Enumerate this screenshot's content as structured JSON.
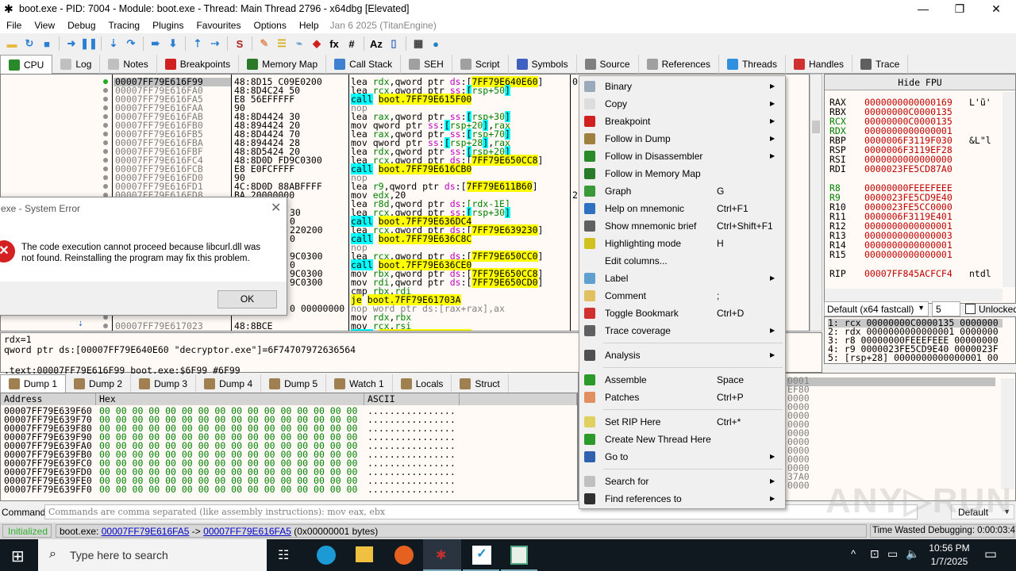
{
  "window": {
    "title": "boot.exe - PID: 7004 - Module: boot.exe - Thread: Main Thread 2796 - x64dbg [Elevated]",
    "min": "—",
    "max": "❐",
    "close": "✕"
  },
  "menu": [
    "File",
    "View",
    "Debug",
    "Tracing",
    "Plugins",
    "Favourites",
    "Options",
    "Help"
  ],
  "version": "Jan 6 2025 (TitanEngine)",
  "toolbar": [
    {
      "name": "open-icon",
      "glyph": "▬",
      "color": "#e8b840"
    },
    {
      "name": "restart-icon",
      "glyph": "↻",
      "color": "#2a7fd4"
    },
    {
      "name": "stop-icon",
      "glyph": "■",
      "color": "#2a7fd4"
    },
    {
      "sep": true
    },
    {
      "name": "run-icon",
      "glyph": "➜",
      "color": "#2a7fd4"
    },
    {
      "name": "pause-icon",
      "glyph": "❚❚",
      "color": "#2a7fd4"
    },
    {
      "sep": true
    },
    {
      "name": "step-into-icon",
      "glyph": "⇣",
      "color": "#2a7fd4"
    },
    {
      "name": "step-over-icon",
      "glyph": "↷",
      "color": "#2a7fd4"
    },
    {
      "sep": true
    },
    {
      "name": "trace-into-icon",
      "glyph": "➠",
      "color": "#2a7fd4"
    },
    {
      "name": "trace-over-icon",
      "glyph": "⬇",
      "color": "#2a7fd4"
    },
    {
      "sep": true
    },
    {
      "name": "execute-till-return-icon",
      "glyph": "⇡",
      "color": "#2a7fd4"
    },
    {
      "name": "run-to-user-code-icon",
      "glyph": "⇢",
      "color": "#2a7fd4"
    },
    {
      "sep": true
    },
    {
      "name": "scylla-icon",
      "glyph": "S",
      "color": "#b02020"
    },
    {
      "sep": true
    },
    {
      "name": "patches-icon",
      "glyph": "✎",
      "color": "#e09060"
    },
    {
      "name": "comments-icon",
      "glyph": "☰",
      "color": "#d4b020"
    },
    {
      "name": "labels-icon",
      "glyph": "⌁",
      "color": "#60a0d0"
    },
    {
      "name": "bookmarks-icon",
      "glyph": "◆",
      "color": "#d02020"
    },
    {
      "name": "functions-icon",
      "glyph": "fx",
      "color": "#000"
    },
    {
      "name": "hash-icon",
      "glyph": "#",
      "color": "#000"
    },
    {
      "sep": true
    },
    {
      "name": "strings-icon",
      "glyph": "Az",
      "color": "#000"
    },
    {
      "name": "device-icon",
      "glyph": "▯",
      "color": "#4070c0"
    },
    {
      "sep": true
    },
    {
      "name": "calculator-icon",
      "glyph": "▦",
      "color": "#404040"
    },
    {
      "name": "globe-icon",
      "glyph": "●",
      "color": "#2080c0"
    }
  ],
  "tabs": [
    {
      "label": "CPU",
      "icon": "cpu-icon",
      "color": "#2a8a2a",
      "active": true
    },
    {
      "label": "Log",
      "icon": "log-icon",
      "color": "#c0c0c0"
    },
    {
      "label": "Notes",
      "icon": "notes-icon",
      "color": "#c0c0c0"
    },
    {
      "label": "Breakpoints",
      "icon": "breakpoint-icon",
      "color": "#d02020"
    },
    {
      "label": "Memory Map",
      "icon": "memory-map-icon",
      "color": "#2a7a2a"
    },
    {
      "label": "Call Stack",
      "icon": "call-stack-icon",
      "color": "#4080d0"
    },
    {
      "label": "SEH",
      "icon": "seh-icon",
      "color": "#a0a0a0"
    },
    {
      "label": "Script",
      "icon": "script-icon",
      "color": "#a0a0a0"
    },
    {
      "label": "Symbols",
      "icon": "symbols-icon",
      "color": "#4060c0"
    },
    {
      "label": "Source",
      "icon": "source-icon",
      "color": "#808080"
    },
    {
      "label": "References",
      "icon": "references-icon",
      "color": "#a0a0a0"
    },
    {
      "label": "Threads",
      "icon": "threads-icon",
      "color": "#3090e0"
    },
    {
      "label": "Handles",
      "icon": "handles-icon",
      "color": "#d03030"
    },
    {
      "label": "Trace",
      "icon": "trace-icon",
      "color": "#606060"
    }
  ],
  "disasm": [
    {
      "addr": "00007FF79E616F99",
      "bytes": "48:8D15 C09E0200",
      "ins": "lea rdx,qword ptr ds:[7FF79E640E60]",
      "cmt": "0",
      "sel": true
    },
    {
      "addr": "00007FF79E616FA0",
      "bytes": "48:8D4C24 50",
      "ins": "lea rcx,qword ptr ss:[rsp+50]"
    },
    {
      "addr": "00007FF79E616FA5",
      "bytes": "E8 56EFFFFF",
      "ins": "call boot.7FF79E615F00"
    },
    {
      "addr": "00007FF79E616FAA",
      "bytes": "90",
      "ins": "nop"
    },
    {
      "addr": "00007FF79E616FAB",
      "bytes": "48:8D4424 30",
      "ins": "lea rax,qword ptr ss:[rsp+30]"
    },
    {
      "addr": "00007FF79E616FB0",
      "bytes": "48:894424 20",
      "ins": "mov qword ptr ss:[rsp+20],rax"
    },
    {
      "addr": "00007FF79E616FB5",
      "bytes": "48:8D4424 70",
      "ins": "lea rax,qword ptr ss:[rsp+70]"
    },
    {
      "addr": "00007FF79E616FBA",
      "bytes": "48:894424 28",
      "ins": "mov qword ptr ss:[rsp+28],rax"
    },
    {
      "addr": "00007FF79E616FBF",
      "bytes": "48:8D5424 20",
      "ins": "lea rdx,qword ptr ss:[rsp+20]"
    },
    {
      "addr": "00007FF79E616FC4",
      "bytes": "48:8D0D FD9C0300",
      "ins": "lea rcx,qword ptr ds:[7FF79E650CC8]"
    },
    {
      "addr": "00007FF79E616FCB",
      "bytes": "E8 E0FCFFFF",
      "ins": "call boot.7FF79E616CB0"
    },
    {
      "addr": "00007FF79E616FD0",
      "bytes": "90",
      "ins": "nop"
    },
    {
      "addr": "00007FF79E616FD1",
      "bytes": "4C:8D0D 88ABFFFF",
      "ins": "lea r9,qword ptr ds:[7FF79E611B60]"
    },
    {
      "addr": "00007FF79E616FD8",
      "bytes": "BA 20000000",
      "ins": "mov edx,20",
      "cmt": "2"
    },
    {
      "frag": "",
      "ins": "lea r8d,qword ptr ds:[rdx-1E]"
    },
    {
      "frag": "30",
      "ins": "lea rcx,qword ptr ss:[rsp+30]"
    },
    {
      "frag": "0",
      "ins": "call boot.7FF79E636DC4"
    },
    {
      "frag": "220200",
      "ins": "lea rcx,qword ptr ds:[7FF79E639230]"
    },
    {
      "frag": "0",
      "ins": "call boot.7FF79E636C8C"
    },
    {
      "frag": "",
      "ins": "nop"
    },
    {
      "frag": "9C0300",
      "ins": "lea rcx,qword ptr ds:[7FF79E650CC0]"
    },
    {
      "frag": "0",
      "ins": "call boot.7FF79E636CE0"
    },
    {
      "frag": "9C0300",
      "ins": "mov rbx,qword ptr ds:[7FF79E650CC8]"
    },
    {
      "frag": "9C0300",
      "ins": "mov rdi,qword ptr ds:[7FF79E650CD0]"
    },
    {
      "frag": "",
      "ins": "cmp rbx,rdi"
    },
    {
      "frag": "",
      "ins": "je boot.7FF79E61703A"
    },
    {
      "frag": "0 00000000",
      "ins": "nop word ptr ds:[rax+rax],ax"
    },
    {
      "frag": "",
      "ins": "mov rdx,rbx"
    },
    {
      "addr": "00007FF79E617023",
      "bytes": "48:8BCE",
      "ins": "mov rcx,rsi"
    },
    {
      "addr": "00007FF79E617026",
      "bytes": "E8 55A90000",
      "ins": "call boot.7FF79E617A80"
    }
  ],
  "registers": {
    "hide_fpu": "Hide FPU",
    "groups": [
      [
        {
          "n": "RAX",
          "v": "0000000000000169",
          "c": "L'ũ'"
        },
        {
          "n": "RBX",
          "v": "00000000C0000135"
        },
        {
          "n": "RCX",
          "v": "00000000C0000135",
          "changed": true
        },
        {
          "n": "RDX",
          "v": "0000000000000001",
          "changed": true
        },
        {
          "n": "RBP",
          "v": "0000006F3119F030",
          "c": "&L\"l"
        },
        {
          "n": "RSP",
          "v": "0000006F3119EF28"
        },
        {
          "n": "RSI",
          "v": "0000000000000000"
        },
        {
          "n": "RDI",
          "v": "0000023FE5CD87A0"
        }
      ],
      [
        {
          "n": "R8",
          "v": "00000000FEEEFEEE",
          "changed": true
        },
        {
          "n": "R9",
          "v": "0000023FE5CD9E40",
          "changed": true
        },
        {
          "n": "R10",
          "v": "0000023FE5CC0000"
        },
        {
          "n": "R11",
          "v": "0000006F3119E401"
        },
        {
          "n": "R12",
          "v": "0000000000000001"
        },
        {
          "n": "R13",
          "v": "0000000000000003"
        },
        {
          "n": "R14",
          "v": "0000000000000001"
        },
        {
          "n": "R15",
          "v": "0000000000000001"
        }
      ],
      [
        {
          "n": "RIP",
          "v": "00007FF845ACFCF4",
          "c": "ntdl"
        }
      ]
    ]
  },
  "callconv": {
    "value": "Default (x64 fastcall)",
    "count": "5",
    "unlocked": "Unlocked"
  },
  "args": [
    "1: rcx 00000000C0000135 0000000",
    "2: rdx 0000000000000001 0000000",
    "3: r8 00000000FEEEFEEE 00000000",
    "4: r9 0000023FE5CD9E40 0000023F",
    "5: [rsp+28] 0000000000000001 00"
  ],
  "info": [
    "rdx=1",
    "qword ptr ds:[00007FF79E640E60 \"decryptor.exe\"]=6F74707972636564",
    "",
    ".text:00007FF79E616F99 boot.exe:$6F99 #6F99"
  ],
  "dumptabs": [
    {
      "label": "Dump 1",
      "icon": "dump-icon",
      "active": true
    },
    {
      "label": "Dump 2",
      "icon": "dump-icon"
    },
    {
      "label": "Dump 3",
      "icon": "dump-icon"
    },
    {
      "label": "Dump 4",
      "icon": "dump-icon"
    },
    {
      "label": "Dump 5",
      "icon": "dump-icon"
    },
    {
      "label": "Watch 1",
      "icon": "watch-icon"
    },
    {
      "label": "Locals",
      "icon": "locals-icon"
    },
    {
      "label": "Struct",
      "icon": "struct-icon"
    }
  ],
  "dump": {
    "headers": [
      "Address",
      "Hex",
      "ASCII"
    ],
    "rows": [
      {
        "a": "00007FF79E639F60",
        "h": "00 00 00 00 00 00 00 00 00 00 00 00 00 00 00 00",
        "s": "................"
      },
      {
        "a": "00007FF79E639F70",
        "h": "00 00 00 00 00 00 00 00 00 00 00 00 00 00 00 00",
        "s": "................"
      },
      {
        "a": "00007FF79E639F80",
        "h": "00 00 00 00 00 00 00 00 00 00 00 00 00 00 00 00",
        "s": "................"
      },
      {
        "a": "00007FF79E639F90",
        "h": "00 00 00 00 00 00 00 00 00 00 00 00 00 00 00 00",
        "s": "................"
      },
      {
        "a": "00007FF79E639FA0",
        "h": "00 00 00 00 00 00 00 00 00 00 00 00 00 00 00 00",
        "s": "................"
      },
      {
        "a": "00007FF79E639FB0",
        "h": "00 00 00 00 00 00 00 00 00 00 00 00 00 00 00 00",
        "s": "................"
      },
      {
        "a": "00007FF79E639FC0",
        "h": "00 00 00 00 00 00 00 00 00 00 00 00 00 00 00 00",
        "s": "................"
      },
      {
        "a": "00007FF79E639FD0",
        "h": "00 00 00 00 00 00 00 00 00 00 00 00 00 00 00 00",
        "s": "................"
      },
      {
        "a": "00007FF79E639FE0",
        "h": "00 00 00 00 00 00 00 00 00 00 00 00 00 00 00 00",
        "s": "................"
      },
      {
        "a": "00007FF79E639FF0",
        "h": "00 00 00 00 00 00 00 00 00 00 00 00 00 00 00 00",
        "s": "................"
      }
    ]
  },
  "stack_fragments": [
    "0001",
    "EF80",
    "0000",
    "0000",
    "0000",
    "0000",
    "0000",
    "0000",
    "0000",
    "0000",
    "0000",
    "37A0",
    "0000"
  ],
  "command": {
    "label": "Command:",
    "placeholder": "Commands are comma separated (like assembly instructions): mov eax, ebx",
    "mode": "Default"
  },
  "status": {
    "state": "Initialized",
    "prefix": "boot.exe: ",
    "from": "00007FF79E616FA5",
    "arrow": " -> ",
    "to": "00007FF79E616FA5",
    "suffix": " (0x00000001 bytes)",
    "time": "Time Wasted Debugging: 0:00:03:47"
  },
  "dialog": {
    "title": "exe - System Error",
    "message": "The code execution cannot proceed because libcurl.dll was not found. Reinstalling the program may fix this problem.",
    "ok": "OK"
  },
  "context_menu": [
    {
      "label": "Binary",
      "sub": true,
      "icon": "binary-icon",
      "color": "#9ab"
    },
    {
      "label": "Copy",
      "sub": true,
      "icon": "copy-icon",
      "color": "#ddd"
    },
    {
      "label": "Breakpoint",
      "sub": true,
      "icon": "breakpoint-icon",
      "color": "#d02020"
    },
    {
      "label": "Follow in Dump",
      "sub": true,
      "icon": "dump-icon",
      "color": "#a08040"
    },
    {
      "label": "Follow in Disassembler",
      "sub": true,
      "icon": "cpu-icon",
      "color": "#2a8a2a"
    },
    {
      "label": "Follow in Memory Map",
      "icon": "memory-map-icon",
      "color": "#2a7a2a"
    },
    {
      "label": "Graph",
      "shortcut": "G",
      "icon": "graph-icon",
      "color": "#3a9a3a"
    },
    {
      "label": "Help on mnemonic",
      "shortcut": "Ctrl+F1",
      "icon": "help-icon",
      "color": "#3070c0"
    },
    {
      "label": "Show mnemonic brief",
      "shortcut": "Ctrl+Shift+F1",
      "icon": "brief-icon",
      "color": "#606060"
    },
    {
      "label": "Highlighting mode",
      "shortcut": "H",
      "icon": "highlighter-icon",
      "color": "#d0c020"
    },
    {
      "label": "Edit columns..."
    },
    {
      "label": "Label",
      "sub": true,
      "icon": "label-icon",
      "color": "#60a0d0"
    },
    {
      "label": "Comment",
      "shortcut": ";",
      "icon": "comment-icon",
      "color": "#e0c060"
    },
    {
      "label": "Toggle Bookmark",
      "shortcut": "Ctrl+D",
      "icon": "bookmark-icon",
      "color": "#d03030"
    },
    {
      "label": "Trace coverage",
      "sub": true,
      "icon": "trace-icon",
      "color": "#606060"
    },
    {
      "sep": true
    },
    {
      "label": "Analysis",
      "sub": true,
      "icon": "wand-icon",
      "color": "#505050"
    },
    {
      "sep": true
    },
    {
      "label": "Assemble",
      "shortcut": "Space",
      "icon": "assemble-icon",
      "color": "#2a9a2a"
    },
    {
      "label": "Patches",
      "shortcut": "Ctrl+P",
      "icon": "patches-icon",
      "color": "#e09060"
    },
    {
      "sep": true
    },
    {
      "label": "Set RIP Here",
      "shortcut": "Ctrl+*",
      "icon": "set-rip-icon",
      "color": "#e0d060"
    },
    {
      "label": "Create New Thread Here",
      "icon": "new-thread-icon",
      "color": "#2a9a2a"
    },
    {
      "label": "Go to",
      "sub": true,
      "icon": "goto-icon",
      "color": "#3060b0"
    },
    {
      "sep": true
    },
    {
      "label": "Search for",
      "sub": true,
      "icon": "search-icon",
      "color": "#c0c0c0"
    },
    {
      "label": "Find references to",
      "sub": true,
      "icon": "binoculars-icon",
      "color": "#303030"
    }
  ],
  "taskbar": {
    "search": "Type here to search",
    "time": "10:56 PM",
    "date": "1/7/2025"
  },
  "watermark": "ANY.RUN"
}
